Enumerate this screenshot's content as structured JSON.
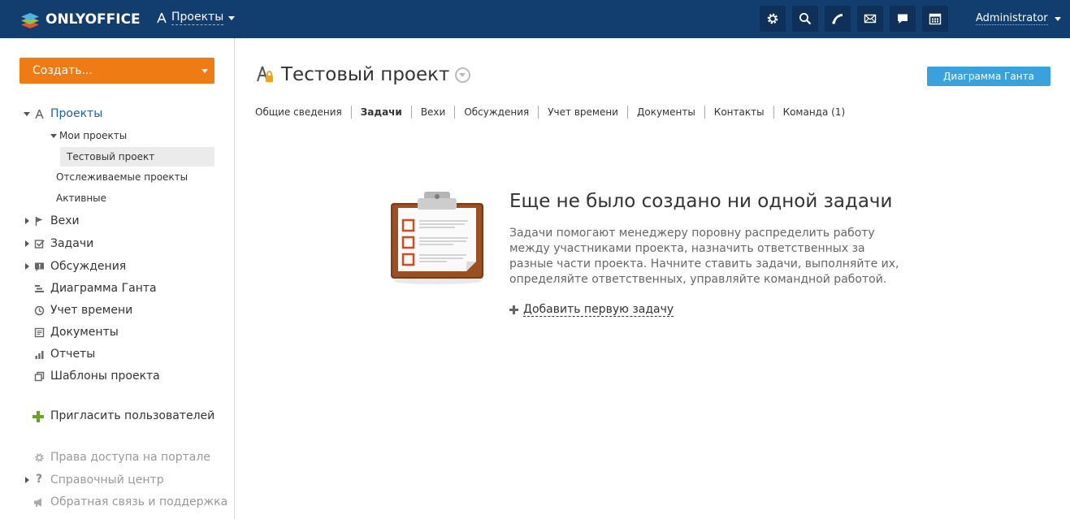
{
  "topbar": {
    "logo_text": "ONLYOFFICE",
    "module_label": "Проекты",
    "user_name": "Administrator",
    "icons": [
      "gear-icon",
      "search-icon",
      "feed-icon",
      "mail-icon",
      "chat-icon",
      "calendar-icon"
    ]
  },
  "sidebar": {
    "create_label": "Создать...",
    "projects_label": "Проекты",
    "my_projects_label": "Мои проекты",
    "selected_project_label": "Тестовый проект",
    "followed_label": "Отслеживаемые проекты",
    "active_label": "Активные",
    "milestones_label": "Вехи",
    "tasks_label": "Задачи",
    "discussions_label": "Обсуждения",
    "gantt_label": "Диаграмма Ганта",
    "time_label": "Учет времени",
    "documents_label": "Документы",
    "reports_label": "Отчеты",
    "templates_label": "Шаблоны проекта",
    "invite_label": "Пригласить пользователей",
    "access_label": "Права доступа на портале",
    "help_label": "Справочный центр",
    "feedback_label": "Обратная связь и поддержка"
  },
  "main": {
    "project_title": "Тестовый проект",
    "gantt_button": "Диаграмма Ганта",
    "tabs": [
      {
        "label": "Общие сведения",
        "active": false
      },
      {
        "label": "Задачи",
        "active": true
      },
      {
        "label": "Вехи",
        "active": false
      },
      {
        "label": "Обсуждения",
        "active": false
      },
      {
        "label": "Учет времени",
        "active": false
      },
      {
        "label": "Документы",
        "active": false
      },
      {
        "label": "Контакты",
        "active": false
      },
      {
        "label": "Команда (1)",
        "active": false
      }
    ],
    "empty_title": "Еще не было создано ни одной задачи",
    "empty_description": "Задачи помогают менеджеру поровну распределить работу между участниками проекта, назначить ответственных за разные части проекта. Начните ставить задачи, выполняйте их, определяйте ответственных, управляйте командной работой.",
    "add_first_label": "Добавить первую задачу"
  },
  "colors": {
    "topbar": "#123d6f",
    "create_button": "#ef7b15",
    "gantt_button": "#3aa1dd"
  }
}
